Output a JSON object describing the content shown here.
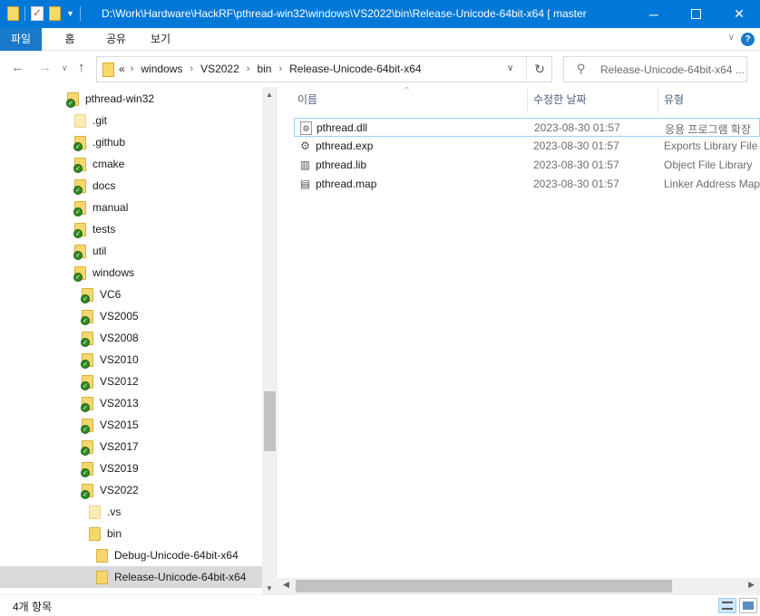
{
  "titlebar": {
    "title": "D:\\Work\\Hardware\\HackRF\\pthread-win32\\windows\\VS2022\\bin\\Release-Unicode-64bit-x64 [ master",
    "minimize": "─",
    "close": "✕"
  },
  "ribbon": {
    "tabs": [
      "파일",
      "홈",
      "공유",
      "보기"
    ],
    "expand_glyph": "∨",
    "help_glyph": "?"
  },
  "nav": {
    "back": "←",
    "forward": "→",
    "recent": "∨",
    "up": "↑",
    "breadcrumb_overflow": "«",
    "breadcrumbs": [
      "windows",
      "VS2022",
      "bin",
      "Release-Unicode-64bit-x64"
    ],
    "refresh": "↻",
    "search_placeholder": "Release-Unicode-64bit-x64 ..."
  },
  "tree": [
    {
      "label": "pthread-win32",
      "indent": 0,
      "badge": true,
      "light": false
    },
    {
      "label": ".git",
      "indent": 1,
      "badge": false,
      "light": true
    },
    {
      "label": ".github",
      "indent": 1,
      "badge": true,
      "light": false
    },
    {
      "label": "cmake",
      "indent": 1,
      "badge": true,
      "light": false
    },
    {
      "label": "docs",
      "indent": 1,
      "badge": true,
      "light": false
    },
    {
      "label": "manual",
      "indent": 1,
      "badge": true,
      "light": false
    },
    {
      "label": "tests",
      "indent": 1,
      "badge": true,
      "light": false
    },
    {
      "label": "util",
      "indent": 1,
      "badge": true,
      "light": false
    },
    {
      "label": "windows",
      "indent": 1,
      "badge": true,
      "light": false
    },
    {
      "label": "VC6",
      "indent": 2,
      "badge": true,
      "light": false
    },
    {
      "label": "VS2005",
      "indent": 2,
      "badge": true,
      "light": false
    },
    {
      "label": "VS2008",
      "indent": 2,
      "badge": true,
      "light": false
    },
    {
      "label": "VS2010",
      "indent": 2,
      "badge": true,
      "light": false
    },
    {
      "label": "VS2012",
      "indent": 2,
      "badge": true,
      "light": false
    },
    {
      "label": "VS2013",
      "indent": 2,
      "badge": true,
      "light": false
    },
    {
      "label": "VS2015",
      "indent": 2,
      "badge": true,
      "light": false
    },
    {
      "label": "VS2017",
      "indent": 2,
      "badge": true,
      "light": false
    },
    {
      "label": "VS2019",
      "indent": 2,
      "badge": true,
      "light": false
    },
    {
      "label": "VS2022",
      "indent": 2,
      "badge": true,
      "light": false
    },
    {
      "label": ".vs",
      "indent": 3,
      "badge": false,
      "light": true
    },
    {
      "label": "bin",
      "indent": 3,
      "badge": false,
      "light": false
    },
    {
      "label": "Debug-Unicode-64bit-x64",
      "indent": 4,
      "badge": false,
      "light": false
    },
    {
      "label": "Release-Unicode-64bit-x64",
      "indent": 4,
      "badge": false,
      "light": false,
      "selected": true
    }
  ],
  "columns": {
    "name": "이름",
    "date": "수정한 날짜",
    "type": "유형",
    "sort_glyph": "^"
  },
  "files": [
    {
      "name": "pthread.dll",
      "date": "2023-08-30 01:57",
      "type": "응용 프로그램 확장",
      "icon": "dll-file-icon",
      "glyph": "⚙"
    },
    {
      "name": "pthread.exp",
      "date": "2023-08-30 01:57",
      "type": "Exports Library File",
      "icon": "exp-file-icon",
      "glyph": "⚙"
    },
    {
      "name": "pthread.lib",
      "date": "2023-08-30 01:57",
      "type": "Object File Library",
      "icon": "lib-file-icon",
      "glyph": "▥"
    },
    {
      "name": "pthread.map",
      "date": "2023-08-30 01:57",
      "type": "Linker Address Map",
      "icon": "map-file-icon",
      "glyph": "▤"
    }
  ],
  "scroll": {
    "up": "▲",
    "down": "▼",
    "left": "◀",
    "right": "▶"
  },
  "status": {
    "item_count": "4개 항목"
  },
  "colors": {
    "titlebar": "#0078d7",
    "file_tab": "#1979ca",
    "selection": "#d9d9d9",
    "focus_border": "#99d1ff",
    "git_badge": "#2e8b20"
  }
}
